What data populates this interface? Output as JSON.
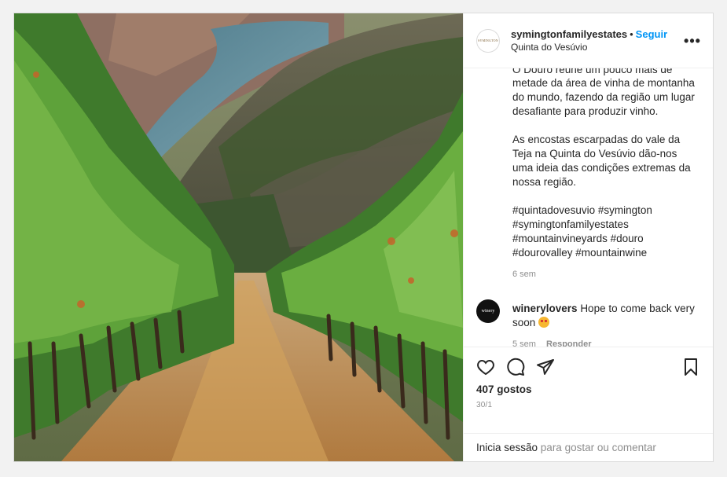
{
  "post": {
    "username": "symingtonfamilyestates",
    "separator": "•",
    "follow_label": "Seguir",
    "location": "Quinta do Vesúvio",
    "avatar_text": "SYMINGTON",
    "more_icon": "more-horizontal-icon"
  },
  "caption": {
    "cut_line": "O Douro reúne um pouco mais de",
    "paragraph1": "metade da área de vinha de montanha do mundo, fazendo da região um lugar desafiante para produzir vinho.",
    "paragraph2": "As encostas escarpadas do vale da Teja na Quinta do Vesúvio dão-nos uma ideia das condições extremas da nossa região.",
    "hashtags": "#quintadovesuvio #symington #symingtonfamilyestates #mountainvineyards #douro #dourovalley #mountainwine",
    "time": "6 sem"
  },
  "comment": {
    "username": "winerylovers",
    "text": "Hope to come back very soon",
    "avatar_text": "winery",
    "time": "5 sem",
    "reply_label": "Responder"
  },
  "actions": {
    "icons": [
      "heart-icon",
      "comment-icon",
      "share-icon",
      "bookmark-icon"
    ],
    "likes": "407 gostos",
    "date": "30/1"
  },
  "footer": {
    "login_link": "Inicia sessão",
    "login_rest": " para gostar ou comentar"
  },
  "colors": {
    "accent": "#0095f6",
    "muted": "#8e8e8e",
    "text": "#262626"
  }
}
